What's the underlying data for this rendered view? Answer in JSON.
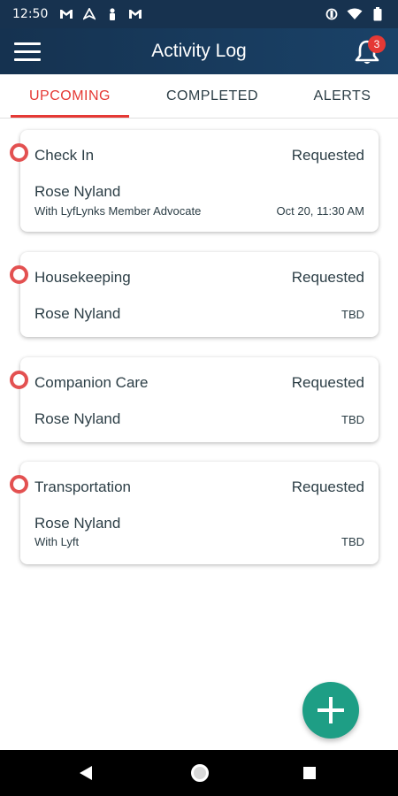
{
  "status_bar": {
    "time": "12:50",
    "left_icons": [
      "gmail-icon",
      "nav-arrow-icon",
      "person-icon",
      "gmail-icon"
    ],
    "right_icons": [
      "vibrate-icon",
      "wifi-icon",
      "battery-icon"
    ]
  },
  "header": {
    "title": "Activity Log",
    "notification_count": "3"
  },
  "tabs": [
    {
      "label": "UPCOMING",
      "active": true
    },
    {
      "label": "COMPLETED",
      "active": false
    },
    {
      "label": "ALERTS",
      "active": false
    }
  ],
  "cards": [
    {
      "title": "Check In",
      "status": "Requested",
      "name": "Rose Nyland",
      "sub": "With LyfLynks Member Advocate",
      "time": "Oct 20, 11:30 AM"
    },
    {
      "title": "Housekeeping",
      "status": "Requested",
      "name": "Rose Nyland",
      "sub": "",
      "time": "TBD"
    },
    {
      "title": "Companion Care",
      "status": "Requested",
      "name": "Rose Nyland",
      "sub": "",
      "time": "TBD"
    },
    {
      "title": "Transportation",
      "status": "Requested",
      "name": "Rose Nyland",
      "sub": "With Lyft",
      "time": "TBD"
    }
  ],
  "colors": {
    "accent": "#e53935",
    "header_bg": "#17324f",
    "fab": "#1e9e85"
  }
}
